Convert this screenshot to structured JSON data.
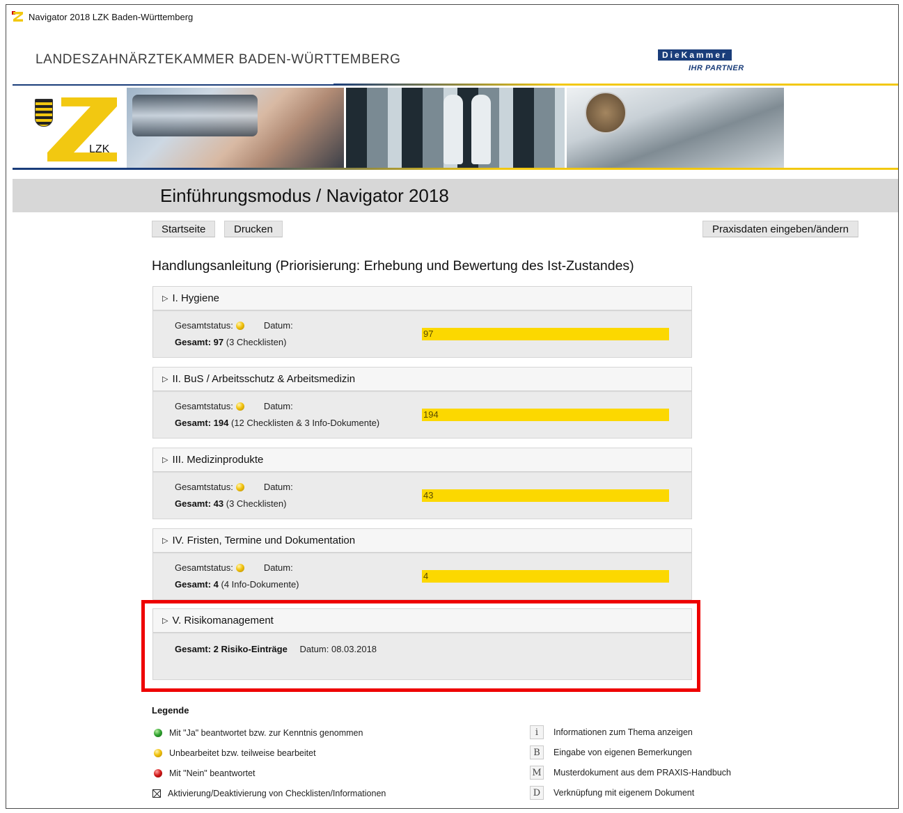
{
  "window": {
    "title": "Navigator 2018 LZK Baden-Württemberg"
  },
  "header": {
    "org": "LANDESZAHNÄRZTEKAMMER BADEN-WÜRTTEMBERG",
    "kammer_logo": "DieKammer",
    "kammer_tag": "IHR PARTNER",
    "lzk_label": "LZK"
  },
  "page": {
    "title": "Einführungsmodus / Navigator 2018"
  },
  "toolbar": {
    "start_label": "Startseite",
    "print_label": "Drucken",
    "praxis_label": "Praxisdaten eingeben/ändern"
  },
  "main": {
    "heading": "Handlungsanleitung (Priorisierung: Erhebung und Bewertung des Ist-Zustandes)",
    "status_label": "Gesamtstatus:",
    "datum_label": "Datum:",
    "gesamt_label": "Gesamt:",
    "sections": [
      {
        "title": "I. Hygiene",
        "total": "97",
        "detail": "(3 Checklisten)",
        "bar_value": 97,
        "bar_fraction": 1.0,
        "status": "yellow"
      },
      {
        "title": "II. BuS / Arbeitsschutz & Arbeitsmedizin",
        "total": "194",
        "detail": "(12 Checklisten & 3 Info-Dokumente)",
        "bar_value": 194,
        "bar_fraction": 1.0,
        "status": "yellow"
      },
      {
        "title": "III. Medizinprodukte",
        "total": "43",
        "detail": "(3 Checklisten)",
        "bar_value": 43,
        "bar_fraction": 1.0,
        "status": "yellow"
      },
      {
        "title": "IV. Fristen, Termine und Dokumentation",
        "total": "4",
        "detail": "(4 Info-Dokumente)",
        "bar_value": 4,
        "bar_fraction": 1.0,
        "status": "yellow"
      }
    ],
    "risk": {
      "title": "V. Risikomanagement",
      "summary": "Gesamt: 2 Risiko-Einträge",
      "datum": "Datum: 08.03.2018"
    }
  },
  "legend": {
    "title": "Legende",
    "status_items": [
      {
        "color": "green",
        "text": "Mit \"Ja\" beantwortet bzw. zur Kenntnis genommen"
      },
      {
        "color": "yellow",
        "text": "Unbearbeitet bzw. teilweise bearbeitet"
      },
      {
        "color": "red",
        "text": "Mit \"Nein\" beantwortet"
      },
      {
        "color": "checkbox",
        "text": "Aktivierung/Deaktivierung von Checklisten/Informationen"
      }
    ],
    "key_items": [
      {
        "key": "i",
        "text": "Informationen zum Thema anzeigen"
      },
      {
        "key": "B",
        "text": "Eingabe von eigenen Bemerkungen"
      },
      {
        "key": "M",
        "text": "Musterdokument aus dem PRAXIS-Handbuch"
      },
      {
        "key": "D",
        "text": "Verknüpfung mit eigenem Dokument"
      }
    ]
  }
}
